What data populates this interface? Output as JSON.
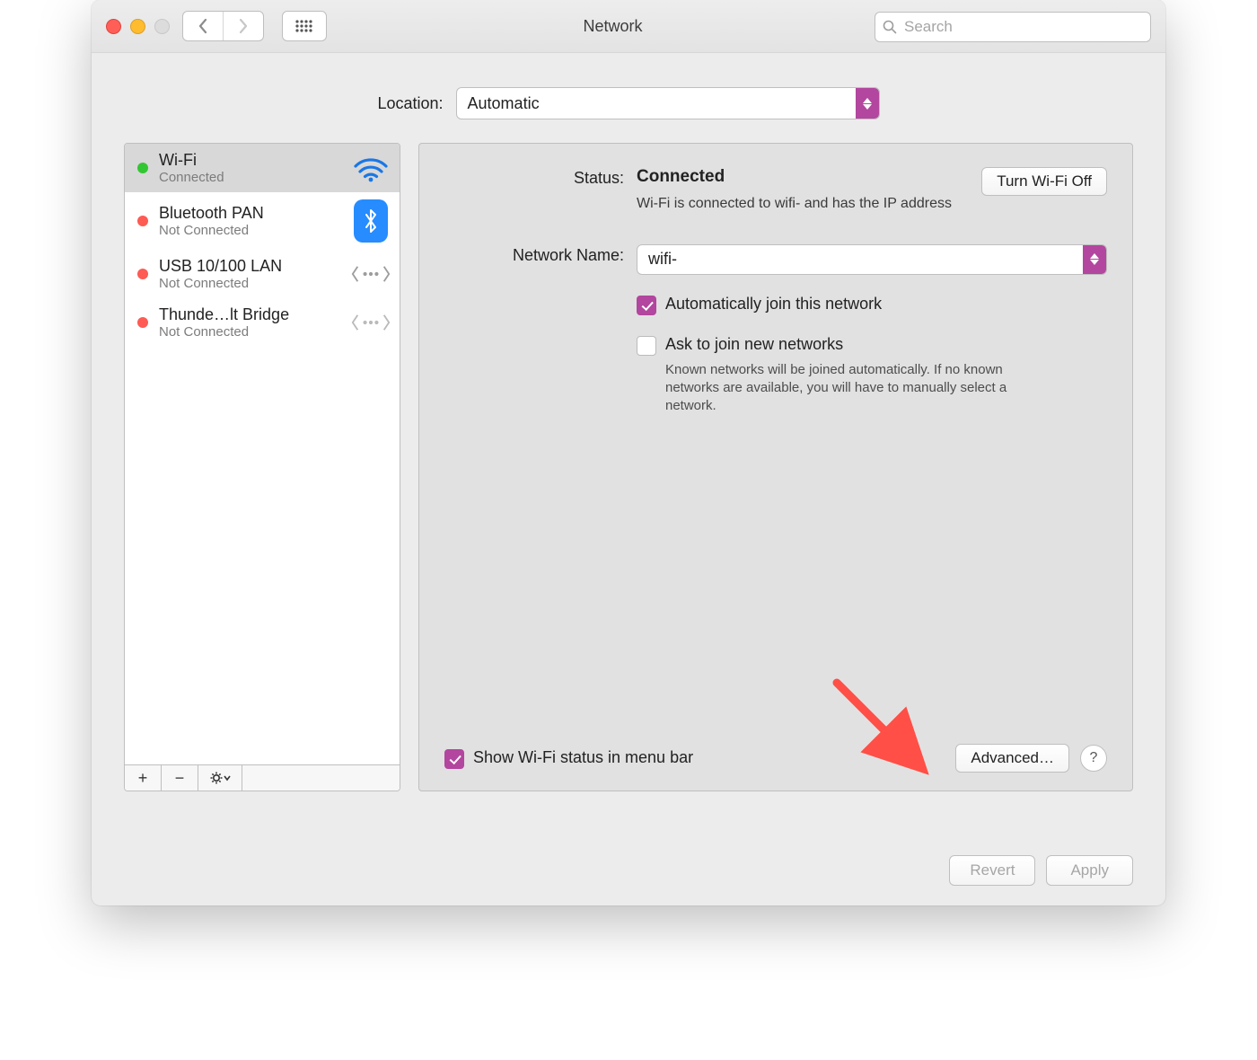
{
  "window": {
    "title": "Network"
  },
  "search": {
    "placeholder": "Search"
  },
  "location": {
    "label": "Location:",
    "value": "Automatic"
  },
  "sidebar": {
    "services": [
      {
        "name": "Wi-Fi",
        "status": "Connected",
        "dot": "green",
        "icon": "wifi"
      },
      {
        "name": "Bluetooth PAN",
        "status": "Not Connected",
        "dot": "red",
        "icon": "bluetooth"
      },
      {
        "name": "USB 10/100 LAN",
        "status": "Not Connected",
        "dot": "red",
        "icon": "ethernet"
      },
      {
        "name": "Thunde…lt Bridge",
        "status": "Not Connected",
        "dot": "red",
        "icon": "ethernet"
      }
    ]
  },
  "detail": {
    "status_label": "Status:",
    "status_value": "Connected",
    "status_sub": "Wi-Fi is connected to wifi-   and has the IP address",
    "wifi_toggle": "Turn Wi-Fi Off",
    "network_name_label": "Network Name:",
    "network_name_value": "wifi-",
    "auto_join": {
      "checked": true,
      "label": "Automatically join this network"
    },
    "ask_join": {
      "checked": false,
      "label": "Ask to join new networks",
      "hint": "Known networks will be joined automatically. If no known networks are available, you will have to manually select a network."
    },
    "show_menu": {
      "checked": true,
      "label": "Show Wi-Fi status in menu bar"
    },
    "advanced_label": "Advanced…",
    "help_label": "?"
  },
  "footer": {
    "revert": "Revert",
    "apply": "Apply"
  },
  "colors": {
    "accent": "#b3469e",
    "arrow": "#ff4f46"
  }
}
